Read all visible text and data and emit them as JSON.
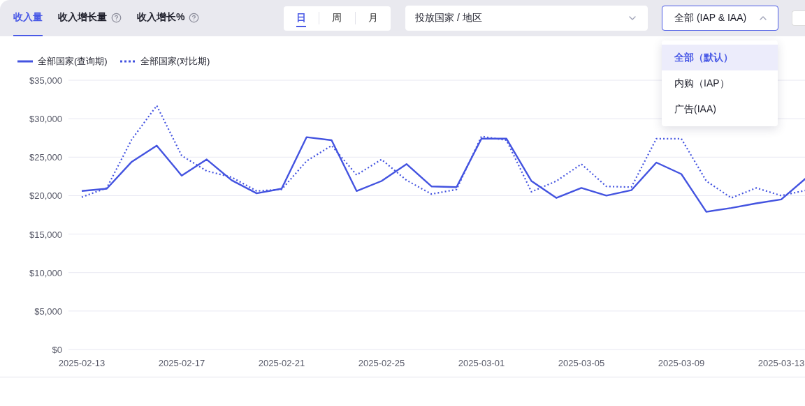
{
  "metric_tabs": [
    {
      "label": "收入量",
      "selected": true,
      "help": false
    },
    {
      "label": "收入增长量",
      "selected": false,
      "help": true
    },
    {
      "label": "收入增长%",
      "selected": false,
      "help": true
    }
  ],
  "granularity": [
    {
      "label": "日",
      "selected": true
    },
    {
      "label": "周",
      "selected": false
    },
    {
      "label": "月",
      "selected": false
    }
  ],
  "country_select": {
    "value": "投放国家 / 地区"
  },
  "revenue_type_select": {
    "value": "全部 (IAP & IAA)",
    "open": true,
    "options": [
      {
        "label": "全部（默认）",
        "selected": true
      },
      {
        "label": "内购（IAP）",
        "selected": false
      },
      {
        "label": "广告(IAA)",
        "selected": false
      }
    ]
  },
  "checkbox": {
    "checked": false
  },
  "chart": {
    "chart_data": {
      "type": "line",
      "categories": [
        "2025-02-13",
        null,
        null,
        null,
        "2025-02-17",
        null,
        null,
        null,
        "2025-02-21",
        null,
        null,
        null,
        "2025-02-25",
        null,
        null,
        null,
        "2025-03-01",
        null,
        null,
        null,
        "2025-03-05",
        null,
        null,
        null,
        "2025-03-09",
        null,
        null,
        null,
        "2025-03-13",
        null
      ],
      "grid": true,
      "series": [
        {
          "name": "全部国家(查询期)",
          "color": "#4353e0",
          "line_style": "solid",
          "values": [
            20600,
            20900,
            24400,
            26500,
            22600,
            24700,
            22000,
            20300,
            20900,
            27600,
            27200,
            20600,
            21900,
            24100,
            21200,
            21100,
            27400,
            27400,
            21900,
            19700,
            21000,
            20000,
            20700,
            24300,
            22800,
            17900,
            18400,
            19000,
            19500,
            22300
          ]
        },
        {
          "name": "全部国家(对比期)",
          "color": "#4353e0",
          "line_style": "dotted",
          "values": [
            19800,
            21000,
            27300,
            31700,
            25200,
            23200,
            22400,
            20600,
            20800,
            24500,
            26500,
            22700,
            24700,
            22000,
            20200,
            20800,
            27700,
            27200,
            20500,
            21900,
            24100,
            21200,
            21100,
            27400,
            27400,
            21900,
            19700,
            21000,
            20000,
            20700
          ]
        }
      ],
      "ylim": [
        0,
        35000
      ],
      "yticks": [
        {
          "value": 0,
          "label": "$0"
        },
        {
          "value": 5000,
          "label": "$5,000"
        },
        {
          "value": 10000,
          "label": "$10,000"
        },
        {
          "value": 15000,
          "label": "$15,000"
        },
        {
          "value": 20000,
          "label": "$20,000"
        },
        {
          "value": 25000,
          "label": "$25,000"
        },
        {
          "value": 30000,
          "label": "$30,000"
        },
        {
          "value": 35000,
          "label": "$35,000"
        }
      ]
    }
  }
}
